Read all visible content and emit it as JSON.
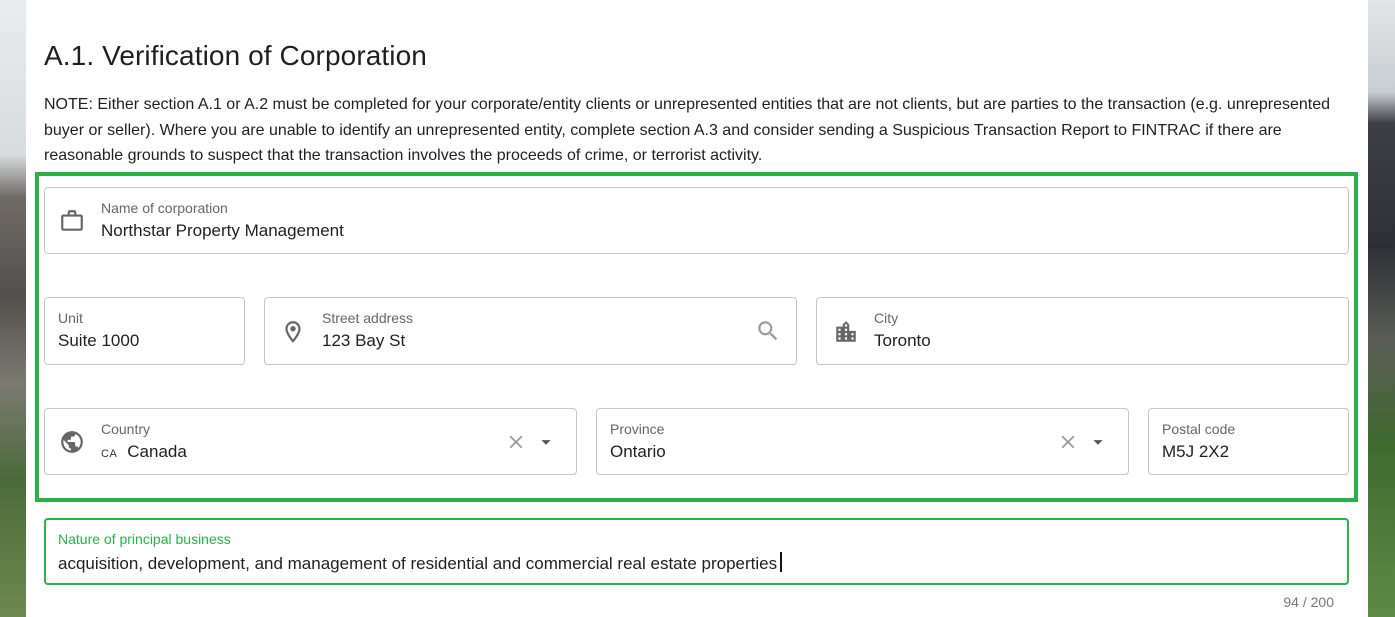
{
  "section": {
    "title": "A.1. Verification of Corporation",
    "note": "NOTE: Either section A.1 or A.2 must be completed for your corporate/entity clients or unrepresented entities that are not clients, but are parties to the transaction (e.g. unrepresented buyer or seller). Where you are unable to identify an unrepresented entity, complete section A.3 and consider sending a Suspicious Transaction Report to FINTRAC if there are reasonable grounds to suspect that the transaction involves the proceeds of crime, or terrorist activity."
  },
  "form": {
    "corporation_name": {
      "label": "Name of corporation",
      "value": "Northstar Property Management",
      "icon": "briefcase-icon"
    },
    "unit": {
      "label": "Unit",
      "value": "Suite 1000"
    },
    "street": {
      "label": "Street address",
      "value": "123 Bay St",
      "icon": "location-pin-icon",
      "action_icon": "search-icon"
    },
    "city": {
      "label": "City",
      "value": "Toronto",
      "icon": "city-icon"
    },
    "country": {
      "label": "Country",
      "code": "CA",
      "value": "Canada",
      "icon": "globe-icon"
    },
    "province": {
      "label": "Province",
      "value": "Ontario"
    },
    "postal_code": {
      "label": "Postal code",
      "value": "M5J 2X2"
    },
    "nature_of_business": {
      "label": "Nature of principal business",
      "value": "acquisition, development, and management of residential and commercial real estate properties",
      "counter": "94 / 200"
    }
  },
  "colors": {
    "accent": "#2bb04a",
    "border": "#c7c7c7",
    "icon": "#666666"
  }
}
